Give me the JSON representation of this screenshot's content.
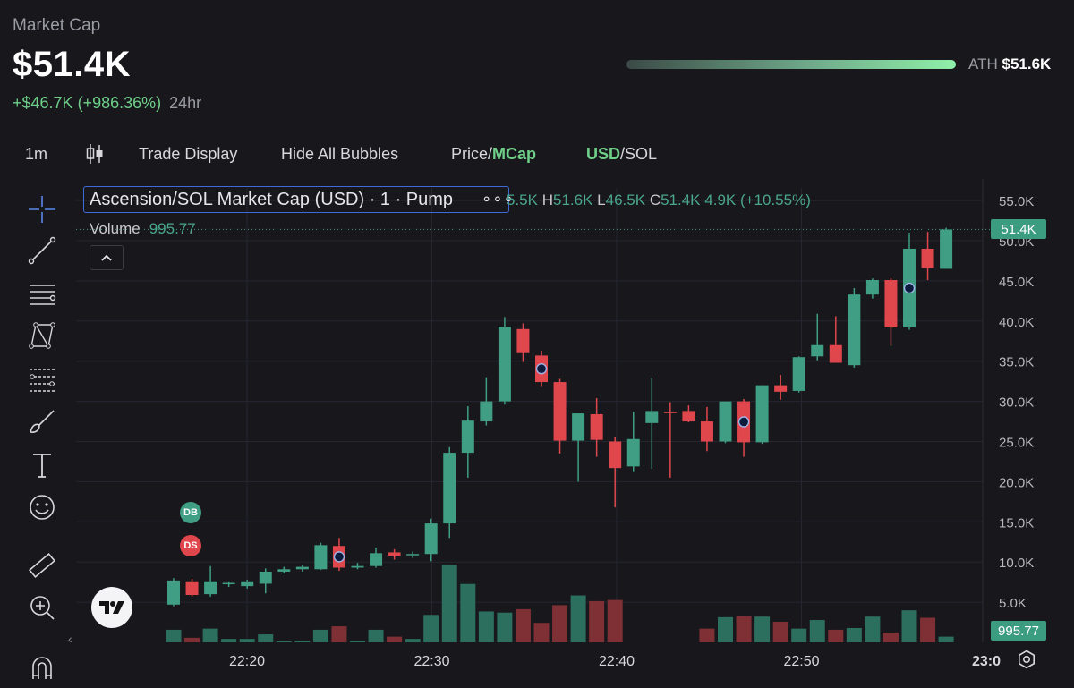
{
  "header": {
    "label": "Market Cap",
    "value": "$51.4K",
    "change": "+$46.7K (+986.36%)",
    "period": "24hr",
    "ath_label": "ATH",
    "ath_value": "$51.6K"
  },
  "toolbar": {
    "interval": "1m",
    "trade_display": "Trade Display",
    "hide_bubbles": "Hide All Bubbles",
    "price_label": "Price/",
    "mcap_label": "MCap",
    "usd_label": "USD",
    "sol_label": "/SOL"
  },
  "legend": {
    "title": "Ascension/SOL Market Cap (USD) · 1 · Pump",
    "dots": "∘∘∘",
    "open_frag": "5.5K",
    "h_label": "H",
    "high": "51.6K",
    "l_label": "L",
    "low": "46.5K",
    "c_label": "C",
    "close": "51.4K",
    "change": "4.9K (+10.55%)",
    "volume_label": "Volume",
    "volume_value": "995.77"
  },
  "markers": {
    "db": "DB",
    "ds": "DS"
  },
  "tags": {
    "last_price": "51.4K",
    "last_volume": "995.77"
  },
  "colors": {
    "up": "#3f9e84",
    "down": "#e0474c",
    "vol_up": "#2c6f5f",
    "vol_down": "#7e3035",
    "bg": "#17171c"
  },
  "icons": [
    "crosshair-icon",
    "trend-line-icon",
    "horizontal-lines-icon",
    "pattern-icon",
    "fib-icon",
    "brush-icon",
    "text-icon",
    "emoji-icon",
    "ruler-icon",
    "zoom-icon",
    "magnet-icon",
    "candles-icon",
    "gear-icon",
    "tradingview-logo-icon"
  ],
  "chart_data": {
    "type": "candlestick",
    "title": "Ascension/SOL Market Cap (USD) · 1 · Pump",
    "xlabel": "",
    "ylabel": "",
    "x_ticks": [
      "22:20",
      "22:30",
      "22:40",
      "22:50",
      "23:0"
    ],
    "y_ticks": [
      "5.0K",
      "10.0K",
      "15.0K",
      "20.0K",
      "25.0K",
      "30.0K",
      "35.0K",
      "40.0K",
      "45.0K",
      "50.0K",
      "55.0K"
    ],
    "ylim": [
      0,
      57000
    ],
    "grid": true,
    "candles": [
      {
        "o": 4700,
        "h": 8000,
        "l": 4500,
        "c": 7700,
        "v": 2200
      },
      {
        "o": 7600,
        "h": 7900,
        "l": 5700,
        "c": 5900,
        "v": 800
      },
      {
        "o": 6000,
        "h": 9500,
        "l": 5700,
        "c": 7600,
        "v": 2400
      },
      {
        "o": 7300,
        "h": 7600,
        "l": 6900,
        "c": 7400,
        "v": 600
      },
      {
        "o": 7000,
        "h": 7800,
        "l": 6700,
        "c": 7600,
        "v": 600
      },
      {
        "o": 7300,
        "h": 9200,
        "l": 6100,
        "c": 8800,
        "v": 1400
      },
      {
        "o": 8800,
        "h": 9400,
        "l": 8600,
        "c": 9100,
        "v": 200
      },
      {
        "o": 9100,
        "h": 9600,
        "l": 8800,
        "c": 9400,
        "v": 300
      },
      {
        "o": 9100,
        "h": 12400,
        "l": 9000,
        "c": 12100,
        "v": 2200
      },
      {
        "o": 12000,
        "h": 13000,
        "l": 8900,
        "c": 9300,
        "v": 2800
      },
      {
        "o": 9300,
        "h": 9900,
        "l": 9100,
        "c": 9500,
        "v": 300
      },
      {
        "o": 9500,
        "h": 11800,
        "l": 9300,
        "c": 11100,
        "v": 2200
      },
      {
        "o": 11200,
        "h": 11600,
        "l": 10300,
        "c": 10800,
        "v": 1000
      },
      {
        "o": 10900,
        "h": 11300,
        "l": 10500,
        "c": 11000,
        "v": 600
      },
      {
        "o": 11000,
        "h": 15400,
        "l": 10100,
        "c": 14800,
        "v": 4800
      },
      {
        "o": 14800,
        "h": 24300,
        "l": 13000,
        "c": 23600,
        "v": 13600
      },
      {
        "o": 23600,
        "h": 29400,
        "l": 20500,
        "c": 27600,
        "v": 10200
      },
      {
        "o": 27500,
        "h": 33000,
        "l": 27000,
        "c": 30000,
        "v": 5400
      },
      {
        "o": 30000,
        "h": 40500,
        "l": 29600,
        "c": 39300,
        "v": 5200
      },
      {
        "o": 39000,
        "h": 39700,
        "l": 34900,
        "c": 36000,
        "v": 5800
      },
      {
        "o": 35700,
        "h": 36300,
        "l": 31800,
        "c": 32400,
        "v": 3400
      },
      {
        "o": 32400,
        "h": 32800,
        "l": 23500,
        "c": 25100,
        "v": 6500
      },
      {
        "o": 25100,
        "h": 25200,
        "l": 20000,
        "c": 28500,
        "v": 8200
      },
      {
        "o": 28400,
        "h": 30400,
        "l": 23100,
        "c": 25200,
        "v": 7200
      },
      {
        "o": 25000,
        "h": 25600,
        "l": 16800,
        "c": 21700,
        "v": 7400
      },
      {
        "o": 21900,
        "h": 28700,
        "l": 21200,
        "c": 25300,
        "v": 0
      },
      {
        "o": 27300,
        "h": 32900,
        "l": 21600,
        "c": 28800,
        "v": 0
      },
      {
        "o": 28700,
        "h": 29900,
        "l": 20500,
        "c": 28600,
        "v": 0
      },
      {
        "o": 28800,
        "h": 29500,
        "l": 27400,
        "c": 27500,
        "v": 0
      },
      {
        "o": 27500,
        "h": 29300,
        "l": 23800,
        "c": 25000,
        "v": 2400
      },
      {
        "o": 25000,
        "h": 29900,
        "l": 24800,
        "c": 30000,
        "v": 4400
      },
      {
        "o": 30000,
        "h": 30300,
        "l": 23100,
        "c": 24900,
        "v": 4600
      },
      {
        "o": 24900,
        "h": 32000,
        "l": 24700,
        "c": 32000,
        "v": 4500
      },
      {
        "o": 32000,
        "h": 33300,
        "l": 30200,
        "c": 31200,
        "v": 3600
      },
      {
        "o": 31300,
        "h": 35600,
        "l": 31100,
        "c": 35500,
        "v": 2400
      },
      {
        "o": 35600,
        "h": 40900,
        "l": 35100,
        "c": 37000,
        "v": 3900
      },
      {
        "o": 37000,
        "h": 40600,
        "l": 34900,
        "c": 34800,
        "v": 2200
      },
      {
        "o": 34500,
        "h": 44100,
        "l": 34200,
        "c": 43300,
        "v": 2500
      },
      {
        "o": 43300,
        "h": 45300,
        "l": 42800,
        "c": 45100,
        "v": 4500
      },
      {
        "o": 45100,
        "h": 45300,
        "l": 36900,
        "c": 39200,
        "v": 1700
      },
      {
        "o": 39200,
        "h": 51000,
        "l": 38900,
        "c": 49000,
        "v": 5600
      },
      {
        "o": 49000,
        "h": 51100,
        "l": 45100,
        "c": 46600,
        "v": 4300
      },
      {
        "o": 46500,
        "h": 51600,
        "l": 46500,
        "c": 51400,
        "v": 1000
      }
    ],
    "trade_bubbles_at": [
      9,
      20,
      31,
      40
    ],
    "last_price": 51400,
    "last_volume": 995.77
  }
}
